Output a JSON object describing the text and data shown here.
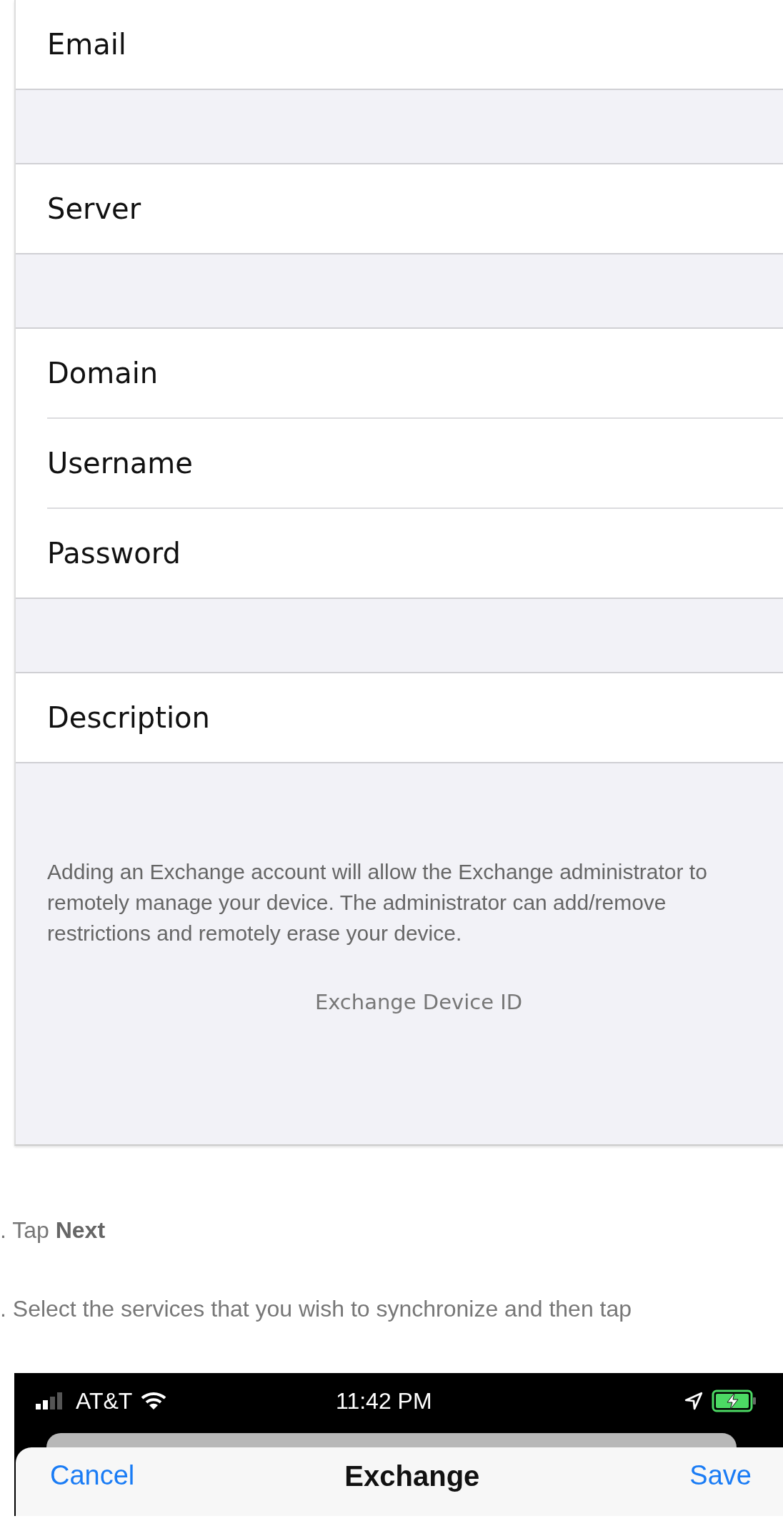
{
  "form": {
    "groups": [
      [
        {
          "label": "Email"
        }
      ],
      [
        {
          "label": "Server"
        }
      ],
      [
        {
          "label": "Domain"
        },
        {
          "label": "Username"
        },
        {
          "label": "Password"
        }
      ],
      [
        {
          "label": "Description"
        }
      ]
    ],
    "notice": "Adding an Exchange account will allow the Exchange administrator to remotely manage your device. The administrator can add/remove restrictions and remotely erase your device.",
    "device_id_label": "Exchange Device ID"
  },
  "steps": [
    {
      "text": ". Tap **Next**"
    },
    {
      "text": ". Select the services that you wish to synchronize and then tap"
    }
  ],
  "phone": {
    "status_bar": {
      "carrier": "AT&T",
      "time": "11:42 PM"
    },
    "sheet": {
      "cancel": "Cancel",
      "title": "Exchange",
      "save": "Save"
    }
  }
}
